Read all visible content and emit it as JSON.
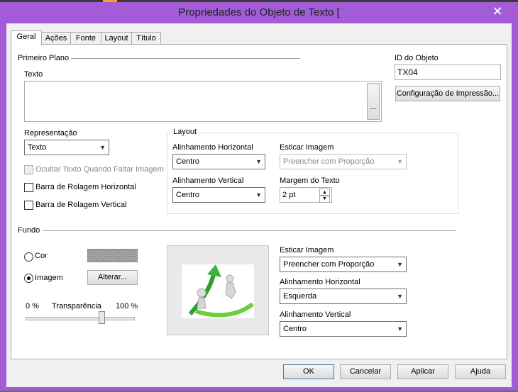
{
  "window": {
    "title": "Propriedades do Objeto de Texto [",
    "close_icon": "close-icon"
  },
  "tabs": [
    {
      "label": "Geral"
    },
    {
      "label": "Ações"
    },
    {
      "label": "Fonte"
    },
    {
      "label": "Layout"
    },
    {
      "label": "Título"
    }
  ],
  "primeiro_plano": {
    "section_label": "Primeiro Plano",
    "texto_label": "Texto",
    "texto_value": "",
    "ellipsis_label": "..."
  },
  "object_id": {
    "label": "ID do Objeto",
    "value": "TX04",
    "print_button": "Configuração de Impressão..."
  },
  "representacao": {
    "label": "Representação",
    "value": "Texto",
    "hide_text_check": "Ocultar Texto Quando Faltar Imagem",
    "hscroll_check": "Barra de Rolagem Horizontal",
    "vscroll_check": "Barra de Rolagem Vertical"
  },
  "layout_group": {
    "label": "Layout",
    "align_h_label": "Alinhamento Horizontal",
    "align_h_value": "Centro",
    "align_v_label": "Alinhamento Vertical",
    "align_v_value": "Centro",
    "stretch_label": "Esticar Imagem",
    "stretch_value": "Preencher com Proporção",
    "margin_label": "Margem do Texto",
    "margin_value": "2 pt"
  },
  "fundo": {
    "section_label": "Fundo",
    "cor_label": "Cor",
    "imagem_label": "Imagem",
    "alterar_button": "Alterar...",
    "transp_min": "0 %",
    "transp_label": "Transparência",
    "transp_max": "100 %",
    "transparency_fraction": 0.71,
    "stretch_label": "Esticar Imagem",
    "stretch_value": "Preencher com Proporção",
    "align_h_label": "Alinhamento Horizontal",
    "align_h_value": "Esquerda",
    "align_v_label": "Alinhamento Vertical",
    "align_v_value": "Centro"
  },
  "footer": {
    "ok": "OK",
    "cancel": "Cancelar",
    "apply": "Aplicar",
    "help": "Ajuda"
  },
  "colors": {
    "titlebar": "#a35bd8",
    "dialog_bg": "#f0f0f0",
    "accent_arrow": "#3db33d"
  }
}
